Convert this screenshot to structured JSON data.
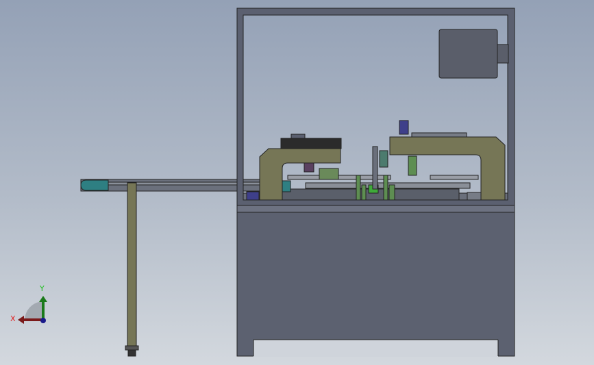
{
  "triad": {
    "x_label": "X",
    "y_label": "Y",
    "x_color": "#e02020",
    "y_color": "#20c020"
  },
  "colors": {
    "frame": "#5b6070",
    "olive": "#767656",
    "cabinet": "#5c6170",
    "motor": "#5a5e6a",
    "teal": "#2e7f82"
  }
}
